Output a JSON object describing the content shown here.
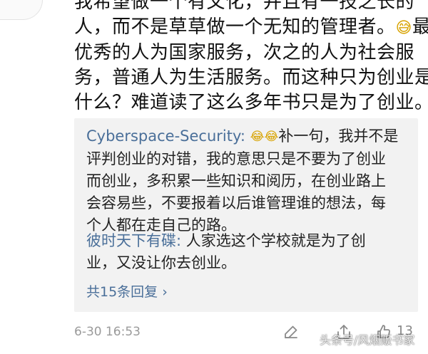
{
  "comment": {
    "lines": [
      "我希望做一个有文化，并且有一技之长的",
      "人，而不是草草做一个无知的管理者。",
      "优秀的人为国家服务，次之的人为社会服",
      "务，普通人为生活服务。而这种只为创业是",
      "什么？难道读了这么多年书只是为了创业。"
    ],
    "line2_tail": "最",
    "emoji_icon": "grinning-sweat-emoji"
  },
  "replies": [
    {
      "author": "Cyberspace-Security:",
      "emoji_icons": [
        "crying-laughing-emoji",
        "crying-laughing-emoji"
      ],
      "lines": [
        "补一句，我并不是",
        "评判创业的对错，我的意思只是不要为了创业",
        "而创业，多积累一些知识和阅历，在创业路上",
        "会容易些，不要报着以后谁管理谁的想法，每",
        "个人都在走自己的路。"
      ]
    },
    {
      "author": "彼时天下有碟:",
      "lines": [
        " 人家选这个学校就是为了创",
        "业，又没让你去创业。"
      ]
    }
  ],
  "more_replies_label": "共15条回复 ›",
  "footer": {
    "timestamp": "6-30 16:53",
    "like_count": "13",
    "icons": [
      "edit-icon",
      "share-icon",
      "like-icon"
    ]
  },
  "watermark": "头条号/风烟贩书家",
  "colors": {
    "author_link": "#4a6f99",
    "reply_background": "#f2f2f2",
    "meta_gray": "#9a9a9a"
  }
}
